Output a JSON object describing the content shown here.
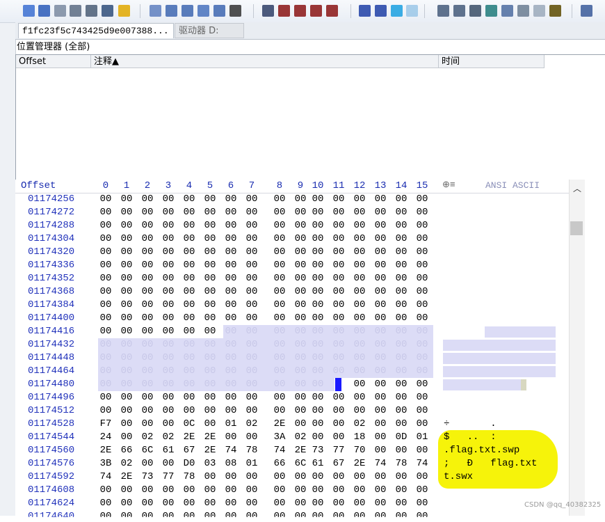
{
  "toolbar": {
    "icons": [
      "new-file",
      "open-file",
      "save",
      "print",
      "print-preview",
      "properties",
      "export",
      "undo",
      "copy",
      "paste",
      "paste-special",
      "copy-hex",
      "binary",
      "find",
      "find-text",
      "find-hex",
      "replace-text",
      "replace-hex",
      "goto-offset",
      "goto-sector",
      "back",
      "forward",
      "disk-tools",
      "disk-clone",
      "disk-image",
      "ram-editor",
      "search-zoom",
      "scan",
      "brush",
      "settings",
      "options"
    ]
  },
  "tabs": [
    "f1fc23f5c743425d9e007388...",
    "驱动器 D:"
  ],
  "position_manager": {
    "title": "位置管理器 (全部)",
    "columns": [
      "Offset",
      "注释▲",
      "时间"
    ]
  },
  "hex_header": {
    "offset_label": "Offset",
    "columns": [
      "0",
      "1",
      "2",
      "3",
      "4",
      "5",
      "6",
      "7",
      "8",
      "9",
      "10",
      "11",
      "12",
      "13",
      "14",
      "15"
    ],
    "ascii_label": "ANSI ASCII"
  },
  "hex_rows": [
    {
      "offset": "01174256",
      "bytes": [
        "00",
        "00",
        "00",
        "00",
        "00",
        "00",
        "00",
        "00",
        "00",
        "00",
        "00",
        "00",
        "00",
        "00",
        "00",
        "00"
      ],
      "ascii": ""
    },
    {
      "offset": "01174272",
      "bytes": [
        "00",
        "00",
        "00",
        "00",
        "00",
        "00",
        "00",
        "00",
        "00",
        "00",
        "00",
        "00",
        "00",
        "00",
        "00",
        "00"
      ],
      "ascii": ""
    },
    {
      "offset": "01174288",
      "bytes": [
        "00",
        "00",
        "00",
        "00",
        "00",
        "00",
        "00",
        "00",
        "00",
        "00",
        "00",
        "00",
        "00",
        "00",
        "00",
        "00"
      ],
      "ascii": ""
    },
    {
      "offset": "01174304",
      "bytes": [
        "00",
        "00",
        "00",
        "00",
        "00",
        "00",
        "00",
        "00",
        "00",
        "00",
        "00",
        "00",
        "00",
        "00",
        "00",
        "00"
      ],
      "ascii": ""
    },
    {
      "offset": "01174320",
      "bytes": [
        "00",
        "00",
        "00",
        "00",
        "00",
        "00",
        "00",
        "00",
        "00",
        "00",
        "00",
        "00",
        "00",
        "00",
        "00",
        "00"
      ],
      "ascii": ""
    },
    {
      "offset": "01174336",
      "bytes": [
        "00",
        "00",
        "00",
        "00",
        "00",
        "00",
        "00",
        "00",
        "00",
        "00",
        "00",
        "00",
        "00",
        "00",
        "00",
        "00"
      ],
      "ascii": ""
    },
    {
      "offset": "01174352",
      "bytes": [
        "00",
        "00",
        "00",
        "00",
        "00",
        "00",
        "00",
        "00",
        "00",
        "00",
        "00",
        "00",
        "00",
        "00",
        "00",
        "00"
      ],
      "ascii": ""
    },
    {
      "offset": "01174368",
      "bytes": [
        "00",
        "00",
        "00",
        "00",
        "00",
        "00",
        "00",
        "00",
        "00",
        "00",
        "00",
        "00",
        "00",
        "00",
        "00",
        "00"
      ],
      "ascii": ""
    },
    {
      "offset": "01174384",
      "bytes": [
        "00",
        "00",
        "00",
        "00",
        "00",
        "00",
        "00",
        "00",
        "00",
        "00",
        "00",
        "00",
        "00",
        "00",
        "00",
        "00"
      ],
      "ascii": ""
    },
    {
      "offset": "01174400",
      "bytes": [
        "00",
        "00",
        "00",
        "00",
        "00",
        "00",
        "00",
        "00",
        "00",
        "00",
        "00",
        "00",
        "00",
        "00",
        "00",
        "00"
      ],
      "ascii": ""
    },
    {
      "offset": "01174416",
      "bytes": [
        "00",
        "00",
        "00",
        "00",
        "00",
        "00",
        "00",
        "00",
        "00",
        "00",
        "00",
        "00",
        "00",
        "00",
        "00",
        "00"
      ],
      "ascii": ""
    },
    {
      "offset": "01174432",
      "bytes": [
        "00",
        "00",
        "00",
        "00",
        "00",
        "00",
        "00",
        "00",
        "00",
        "00",
        "00",
        "00",
        "00",
        "00",
        "00",
        "00"
      ],
      "ascii": ""
    },
    {
      "offset": "01174448",
      "bytes": [
        "00",
        "00",
        "00",
        "00",
        "00",
        "00",
        "00",
        "00",
        "00",
        "00",
        "00",
        "00",
        "00",
        "00",
        "00",
        "00"
      ],
      "ascii": ""
    },
    {
      "offset": "01174464",
      "bytes": [
        "00",
        "00",
        "00",
        "00",
        "00",
        "00",
        "00",
        "00",
        "00",
        "00",
        "00",
        "00",
        "00",
        "00",
        "00",
        "00"
      ],
      "ascii": ""
    },
    {
      "offset": "01174480",
      "bytes": [
        "00",
        "00",
        "00",
        "00",
        "00",
        "00",
        "00",
        "00",
        "00",
        "00",
        "00",
        "",
        "00",
        "00",
        "00",
        "00"
      ],
      "ascii": ""
    },
    {
      "offset": "01174496",
      "bytes": [
        "00",
        "00",
        "00",
        "00",
        "00",
        "00",
        "00",
        "00",
        "00",
        "00",
        "00",
        "00",
        "00",
        "00",
        "00",
        "00"
      ],
      "ascii": ""
    },
    {
      "offset": "01174512",
      "bytes": [
        "00",
        "00",
        "00",
        "00",
        "00",
        "00",
        "00",
        "00",
        "00",
        "00",
        "00",
        "00",
        "00",
        "00",
        "00",
        "00"
      ],
      "ascii": ""
    },
    {
      "offset": "01174528",
      "bytes": [
        "F7",
        "00",
        "00",
        "00",
        "0C",
        "00",
        "01",
        "02",
        "2E",
        "00",
        "00",
        "00",
        "02",
        "00",
        "00",
        "00"
      ],
      "ascii": "÷       ."
    },
    {
      "offset": "01174544",
      "bytes": [
        "24",
        "00",
        "02",
        "02",
        "2E",
        "2E",
        "00",
        "00",
        "3A",
        "02",
        "00",
        "00",
        "18",
        "00",
        "0D",
        "01"
      ],
      "ascii": "$   ..  :"
    },
    {
      "offset": "01174560",
      "bytes": [
        "2E",
        "66",
        "6C",
        "61",
        "67",
        "2E",
        "74",
        "78",
        "74",
        "2E",
        "73",
        "77",
        "70",
        "00",
        "00",
        "00"
      ],
      "ascii": ".flag.txt.swp"
    },
    {
      "offset": "01174576",
      "bytes": [
        "3B",
        "02",
        "00",
        "00",
        "D0",
        "03",
        "08",
        "01",
        "66",
        "6C",
        "61",
        "67",
        "2E",
        "74",
        "78",
        "74"
      ],
      "ascii": ";   Ð   flag.txt"
    },
    {
      "offset": "01174592",
      "bytes": [
        "74",
        "2E",
        "73",
        "77",
        "78",
        "00",
        "00",
        "00",
        "00",
        "00",
        "00",
        "00",
        "00",
        "00",
        "00",
        "00"
      ],
      "ascii": "t.swx"
    },
    {
      "offset": "01174608",
      "bytes": [
        "00",
        "00",
        "00",
        "00",
        "00",
        "00",
        "00",
        "00",
        "00",
        "00",
        "00",
        "00",
        "00",
        "00",
        "00",
        "00"
      ],
      "ascii": ""
    },
    {
      "offset": "01174624",
      "bytes": [
        "00",
        "00",
        "00",
        "00",
        "00",
        "00",
        "00",
        "00",
        "00",
        "00",
        "00",
        "00",
        "00",
        "00",
        "00",
        "00"
      ],
      "ascii": ""
    }
  ],
  "partial_row_offset": "01174640",
  "watermark": "CSDN @qq_40382325",
  "colors": {
    "offset_blue": "#2233bb",
    "selection_band": "#dcdcf6",
    "cursor": "#1a1aff",
    "highlight_yellow": "#f6f30a"
  }
}
